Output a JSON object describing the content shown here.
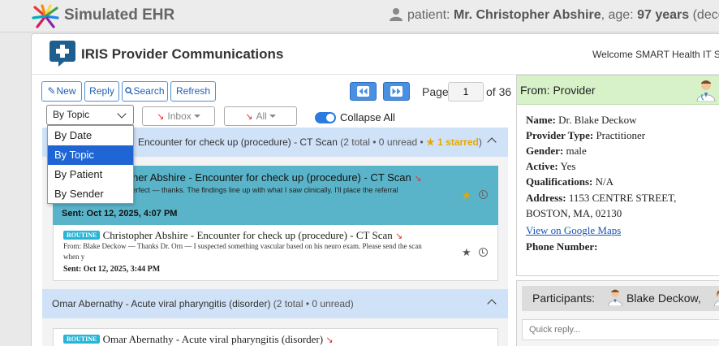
{
  "ehr": {
    "title": "Simulated EHR",
    "patient_prefix": "patient: ",
    "patient_name": "Mr. Christopher Abshire",
    "patient_age_prefix": ", age: ",
    "patient_age": "97 years",
    "patient_suffix": " (deceas"
  },
  "app": {
    "title": "IRIS Provider Communications",
    "welcome": "Welcome SMART Health IT Sand"
  },
  "toolbar": {
    "new_label": "New",
    "reply_label": "Reply",
    "search_label": "Search",
    "refresh_label": "Refresh"
  },
  "pagination": {
    "page_label": "Page",
    "page_value": "1",
    "of_label": "of 36"
  },
  "filters": {
    "group_by_selected": "By Topic",
    "group_by_options": [
      "By Date",
      "By Topic",
      "By Patient",
      "By Sender"
    ],
    "inbox_label": "Inbox",
    "all_label": "All",
    "collapse_label": "Collapse All"
  },
  "groups": [
    {
      "title": "Encounter for check up (procedure) - CT Scan",
      "count": "(2 total • 0 unread • ",
      "starred": "1 starred",
      "count_close": ")"
    },
    {
      "title": "Omar Abernathy - Acute viral pharyngitis (disorder)",
      "count": "(2 total • 0 unread)"
    }
  ],
  "messages": {
    "selected": {
      "title": "topher Abshire - Encounter for check up (procedure) - CT Scan",
      "preview": "— Perfect — thanks. The findings line up with what I saw clinically. I'll place the referral",
      "sent": "Sent: Oct 12, 2025, 4:07 PM"
    },
    "second": {
      "badge": "ROUTINE",
      "title": "Christopher Abshire - Encounter for check up (procedure) - CT Scan",
      "preview": "From: Blake Deckow — Thanks Dr. Orn — I suspected something vascular based on his neuro exam. Please send the scan when y",
      "sent": "Sent: Oct 12, 2025, 3:44 PM"
    },
    "third": {
      "badge": "ROUTINE",
      "title": "Omar Abernathy - Acute viral pharyngitis (disorder)"
    }
  },
  "provider": {
    "header": "From: Provider",
    "name_label": "Name:",
    "name": "Dr. Blake Deckow",
    "type_label": "Provider Type:",
    "type": "Practitioner",
    "gender_label": "Gender:",
    "gender": "male",
    "active_label": "Active:",
    "active": "Yes",
    "qual_label": "Qualifications:",
    "qual": "N/A",
    "address_label": "Address:",
    "address": "1153 CENTRE STREET, BOSTON, MA, 02130",
    "map_link": "View on Google Maps",
    "phone_label": "Phone Number:"
  },
  "participants": {
    "label": "Participants:",
    "first": "Blake Deckow,",
    "quick_reply_placeholder": "Quick reply..."
  },
  "colors": {
    "accent_blue": "#4a90e2",
    "selected_message": "#5ab4c9",
    "group_header": "#cfe2f7",
    "provider_header": "#d7f2c8",
    "routine_badge": "#27b6d6",
    "star": "#e8a800"
  },
  "icons": [
    "ehr-logo-icon",
    "user-icon",
    "iris-logo-icon",
    "pencil-icon",
    "search-icon",
    "rewind-icon",
    "fast-forward-icon",
    "star-icon",
    "clock-icon",
    "doctor-icon"
  ]
}
